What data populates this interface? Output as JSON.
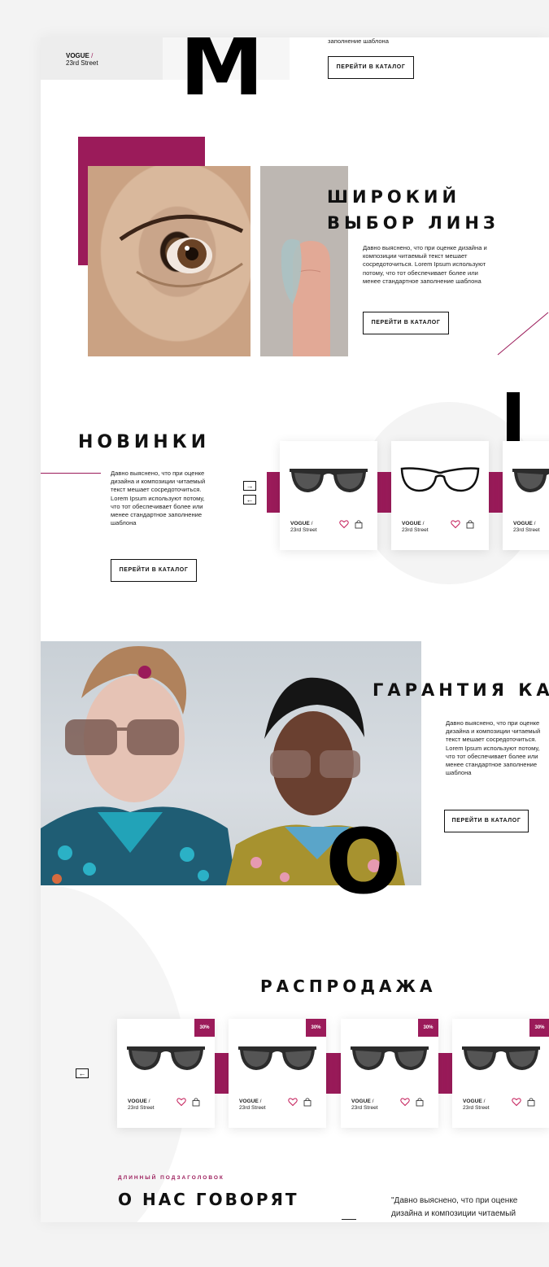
{
  "top": {
    "brand": "VOGUE",
    "slash": "/",
    "street": "23rd Street",
    "big_letter": "M",
    "text_tail": "заполнение шаблона",
    "button": "ПЕРЕЙТИ В КАТАЛОГ"
  },
  "lenses": {
    "title_line1": "ШИРОКИЙ",
    "title_line2": "ВЫБОР ЛИНЗ",
    "text": "Давно выяснено, что при оценке дизайна и композиции читаемый текст мешает сосредоточиться. Lorem Ipsum используют потому, что тот обеспечивает более или менее стандартное заполнение шаблона",
    "button": "ПЕРЕЙТИ В КАТАЛОГ"
  },
  "new": {
    "title": "НОВИНКИ",
    "text": "Давно выяснено, что при оценке дизайна и композиции читаемый текст мешает сосредоточиться. Lorem Ipsum используют потому, что тот обеспечивает более или менее стандартное заполнение шаблона",
    "button": "ПЕРЕЙТИ В КАТАЛОГ",
    "arrow_next": "→",
    "arrow_prev": "←",
    "cards": [
      {
        "brand": "VOGUE",
        "slash": "/",
        "street": "23rd Street"
      },
      {
        "brand": "VOGUE",
        "slash": "/",
        "street": "23rd Street"
      },
      {
        "brand": "VOGUE",
        "slash": "/",
        "street": "23rd Street"
      }
    ]
  },
  "quality": {
    "title": "ГАРАНТИЯ КАЧЕ",
    "big_letter": "O",
    "text": "Давно выяснено, что при оценке дизайна и композиции читаемый текст мешает сосредоточиться. Lorem Ipsum используют потому, что тот обеспечивает более или менее стандартное заполнение шаблона",
    "button": "ПЕРЕЙТИ В КАТАЛОГ"
  },
  "sale": {
    "title": "РАСПРОДАЖА",
    "arrow_prev": "←",
    "cards": [
      {
        "badge": "30%",
        "brand": "VOGUE",
        "slash": "/",
        "street": "23rd Street"
      },
      {
        "badge": "30%",
        "brand": "VOGUE",
        "slash": "/",
        "street": "23rd Street"
      },
      {
        "badge": "30%",
        "brand": "VOGUE",
        "slash": "/",
        "street": "23rd Street"
      },
      {
        "badge": "30%",
        "brand": "VOGUE",
        "slash": "/",
        "street": "23rd Street"
      }
    ]
  },
  "reviews": {
    "subtitle": "ДЛИННЫЙ ПОДЗАГОЛОВОК",
    "title": "О НАС ГОВОРЯТ",
    "quote": "\"Давно выяснено, что при оценке дизайна и композиции читаемый"
  },
  "colors": {
    "accent": "#9b1b5a",
    "dark": "#111111",
    "light_bg": "#f3f3f3"
  }
}
